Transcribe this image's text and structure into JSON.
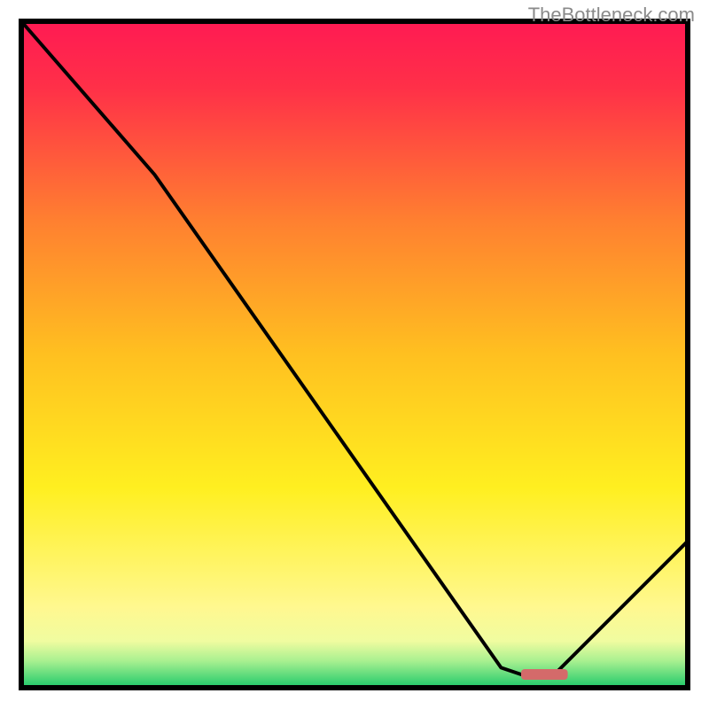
{
  "watermark": "TheBottleneck.com",
  "chart_data": {
    "type": "line",
    "title": "",
    "xlabel": "",
    "ylabel": "",
    "xlim": [
      0,
      100
    ],
    "ylim": [
      0,
      100
    ],
    "grid": false,
    "background_gradient": {
      "stops": [
        {
          "offset": 0.0,
          "color": "#ff1a53"
        },
        {
          "offset": 0.1,
          "color": "#ff3048"
        },
        {
          "offset": 0.3,
          "color": "#ff8030"
        },
        {
          "offset": 0.5,
          "color": "#ffc020"
        },
        {
          "offset": 0.7,
          "color": "#ffef20"
        },
        {
          "offset": 0.88,
          "color": "#fff890"
        },
        {
          "offset": 0.93,
          "color": "#f0fca0"
        },
        {
          "offset": 0.96,
          "color": "#a8f090"
        },
        {
          "offset": 1.0,
          "color": "#1ec96a"
        }
      ]
    },
    "series": [
      {
        "name": "bottleneck-curve",
        "type": "line",
        "color": "#000000",
        "x": [
          0,
          20,
          72,
          75,
          80,
          100
        ],
        "values": [
          100,
          77,
          3,
          2,
          2,
          22
        ]
      }
    ],
    "markers": [
      {
        "name": "optimal-range",
        "type": "bar-marker",
        "color": "#d46a6a",
        "x_start": 75,
        "x_end": 82,
        "y": 2
      }
    ]
  }
}
